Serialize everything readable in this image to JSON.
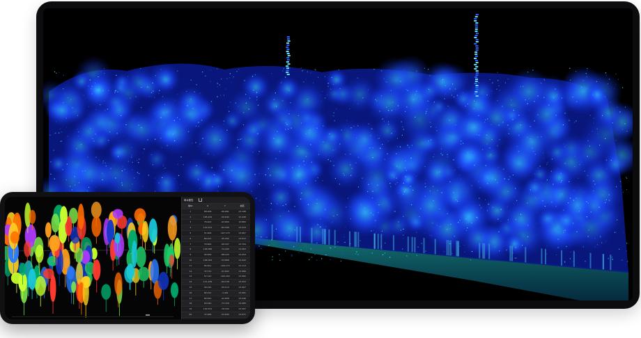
{
  "viewer": {
    "main_view_label": "point-cloud-forest-view",
    "colors": {
      "background": "#000000",
      "canopy_dark": "#0a1fb5",
      "canopy_mid": "#1f4fff",
      "canopy_light": "#33c7ff",
      "ground": "#1a9b9e"
    }
  },
  "phone": {
    "panel_title": "单木属性",
    "table": {
      "headers": [
        "树ID",
        "X",
        "Y",
        "树高"
      ],
      "rows": [
        [
          "1",
          "68.208",
          "-66.081",
          "13.198"
        ],
        [
          "2",
          "165.222",
          "-50.644",
          "13.448"
        ],
        [
          "3",
          "76.403",
          "-94.800",
          "13.860"
        ],
        [
          "4",
          "122.211",
          "-82.180",
          "13.219"
        ],
        [
          "5",
          "51.606",
          "-107.175",
          "13.667"
        ],
        [
          "6",
          "66.221",
          "-35.292",
          "13.072"
        ],
        [
          "7",
          "79.600",
          "-96.187",
          "13.794"
        ],
        [
          "8",
          "106.380",
          "-72.184",
          "13.063"
        ],
        [
          "9",
          "94.819",
          "-88.193",
          "13.254"
        ],
        [
          "10",
          "106.302",
          "-53.668",
          "13.222"
        ],
        [
          "11",
          "84.811",
          "-109.174",
          "13.114"
        ],
        [
          "12",
          "72.710",
          "-91.602",
          "13.466"
        ],
        [
          "13",
          "57.143",
          "-100.200",
          "13.082"
        ],
        [
          "14",
          "111.239",
          "-62.138",
          "13.253"
        ],
        [
          "15",
          "90.144",
          "-55.110",
          "13.067"
        ],
        [
          "16",
          "82.411",
          "-1.401",
          "13.081"
        ],
        [
          "17",
          "80.810",
          "-42.808",
          "13.246"
        ],
        [
          "18",
          "59.240",
          "-73.700",
          "13.085"
        ],
        [
          "19",
          "100.531",
          "-78.184",
          "13.397"
        ],
        [
          "20",
          "72.289",
          "-23.609",
          "13.071"
        ],
        [
          "21",
          "68.867",
          "-7.860",
          "13.388"
        ],
        [
          "22",
          "182.310",
          "-101.100",
          "13.164"
        ],
        [
          "23",
          "77.001",
          "-64.181",
          "13.162"
        ],
        [
          "24",
          "71.610",
          "-40.117",
          "13.059"
        ],
        [
          "25",
          "84.431",
          "-83.114",
          "13.180"
        ]
      ]
    }
  }
}
